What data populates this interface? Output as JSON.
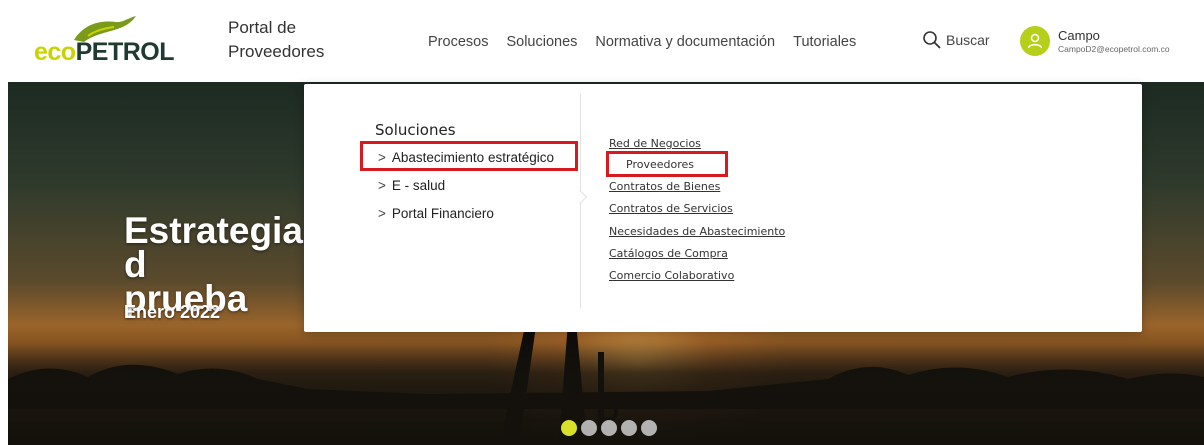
{
  "header": {
    "logo": {
      "text_eco": "eco",
      "text_petrol": "PETROL"
    },
    "portal_title_line1": "Portal de",
    "portal_title_line2": "Proveedores",
    "nav": [
      "Procesos",
      "Soluciones",
      "Normativa y documentación",
      "Tutoriales"
    ],
    "search_label": "Buscar",
    "user": {
      "name": "Campo",
      "email": "CampoD2@ecopetrol.com.co"
    }
  },
  "hero": {
    "title_line1": "Estrategia d",
    "title_line2": "prueba",
    "date": "Enero 2022",
    "carousel_dots": 5,
    "active_dot": 1
  },
  "dropdown": {
    "title": "Soluciones",
    "items": [
      "Abastecimiento estratégico",
      "E - salud",
      "Portal Financiero"
    ],
    "selected_item": "Abastecimiento estratégico",
    "links": [
      "Red de Negocios",
      "Proveedores",
      "Contratos de Bienes",
      "Contratos de Servicios",
      "Necesidades de Abastecimiento",
      "Catálogos de Compra",
      "Comercio Colaborativo"
    ],
    "highlighted_link": "Proveedores"
  },
  "colors": {
    "brand_green": "#c8d400",
    "brand_dark": "#1f3a2e",
    "avatar_green": "#b5cf1a",
    "highlight_red": "#d71920",
    "active_dot": "#d8e02a"
  },
  "icons": {
    "search": "search-icon",
    "user": "user-icon",
    "chevron": "chevron-right-icon",
    "logo_mark": "iguana-logo-icon"
  }
}
